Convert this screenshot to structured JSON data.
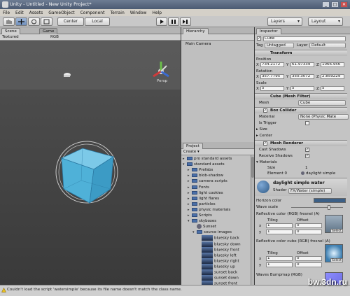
{
  "window": {
    "title": "Unity - Untitled - New Unity Project*"
  },
  "menu": [
    "File",
    "Edit",
    "Assets",
    "GameObject",
    "Component",
    "Terrain",
    "Window",
    "Help"
  ],
  "toolbar": {
    "pivot_center": "Center",
    "pivot_local": "Local",
    "layers": "Layers",
    "layout": "Layout"
  },
  "scene": {
    "tabs": [
      "Scene",
      "Game"
    ],
    "render_mode": "Textured",
    "color_mode": "RGB",
    "gizmo_label": "Persp"
  },
  "hierarchy": {
    "title": "Hierarchy",
    "items": [
      "Main Camera"
    ]
  },
  "project": {
    "title": "Project",
    "create_label": "Create ▾",
    "items": [
      {
        "label": "pro standard assets",
        "indent": 0,
        "kind": "folder",
        "arrow": "▸"
      },
      {
        "label": "standard assets",
        "indent": 0,
        "kind": "folder",
        "arrow": "▾"
      },
      {
        "label": "Prefabs",
        "indent": 1,
        "kind": "folder",
        "arrow": "▸"
      },
      {
        "label": "blob-shadow",
        "indent": 1,
        "kind": "folder",
        "arrow": "▸"
      },
      {
        "label": "camera scripts",
        "indent": 1,
        "kind": "folder",
        "arrow": "▸"
      },
      {
        "label": "Fonts",
        "indent": 1,
        "kind": "folder",
        "arrow": "▸"
      },
      {
        "label": "light cookies",
        "indent": 1,
        "kind": "folder",
        "arrow": "▸"
      },
      {
        "label": "light flares",
        "indent": 1,
        "kind": "folder",
        "arrow": "▸"
      },
      {
        "label": "particles",
        "indent": 1,
        "kind": "folder",
        "arrow": "▸"
      },
      {
        "label": "physic materials",
        "indent": 1,
        "kind": "folder",
        "arrow": "▸"
      },
      {
        "label": "Scripts",
        "indent": 1,
        "kind": "folder",
        "arrow": "▸"
      },
      {
        "label": "skyboxes",
        "indent": 1,
        "kind": "folder",
        "arrow": "▾"
      },
      {
        "label": "Sunset",
        "indent": 2,
        "kind": "sphere",
        "arrow": ""
      },
      {
        "label": "source images",
        "indent": 2,
        "kind": "folder",
        "arrow": "▾"
      },
      {
        "label": "bluesky back",
        "indent": 3,
        "kind": "thumb",
        "arrow": ""
      },
      {
        "label": "bluesky down",
        "indent": 3,
        "kind": "thumb",
        "arrow": ""
      },
      {
        "label": "bluesky front",
        "indent": 3,
        "kind": "thumb",
        "arrow": ""
      },
      {
        "label": "bluesky left",
        "indent": 3,
        "kind": "thumb",
        "arrow": ""
      },
      {
        "label": "bluesky right",
        "indent": 3,
        "kind": "thumb",
        "arrow": ""
      },
      {
        "label": "bluesky up",
        "indent": 3,
        "kind": "thumb",
        "arrow": ""
      },
      {
        "label": "sunset back",
        "indent": 3,
        "kind": "thumb",
        "arrow": ""
      },
      {
        "label": "sunset down",
        "indent": 3,
        "kind": "thumb",
        "arrow": ""
      },
      {
        "label": "sunset front",
        "indent": 3,
        "kind": "thumb",
        "arrow": ""
      }
    ]
  },
  "inspector": {
    "title": "Inspector",
    "object_name": "Cube",
    "tag_label": "Tag",
    "tag_value": "Untagged",
    "layer_label": "Layer",
    "layer_value": "Default",
    "transform": {
      "header": "Transform",
      "position_label": "Position",
      "position": {
        "x": "734.2172",
        "y": "61.97339",
        "z": "1066.956"
      },
      "rotation_label": "Rotation",
      "rotation": {
        "x": "357.7795",
        "y": "350.3072",
        "z": "2.859229"
      },
      "scale_label": "Scale",
      "scale": {
        "x": "5",
        "y": "5",
        "z": "5"
      }
    },
    "mesh_filter": {
      "header": "Cube (Mesh Filter)",
      "mesh_label": "Mesh",
      "mesh_value": "Cube"
    },
    "box_collider": {
      "header": "Box Collider",
      "material_label": "Material",
      "material_value": "None (Physic Mate",
      "is_trigger_label": "Is Trigger",
      "size_label": "Size",
      "center_label": "Center"
    },
    "mesh_renderer": {
      "header": "Mesh Renderer",
      "cast_shadows_label": "Cast Shadows",
      "receive_shadows_label": "Receive Shadows",
      "materials_label": "Materials",
      "size_label": "Size",
      "size_value": "1",
      "element_label": "Element 0",
      "element_value": "daylight simple"
    },
    "material": {
      "name": "daylight simple water",
      "shader_label": "Shader",
      "shader_value": "FX/Water (simple)",
      "horizon_label": "Horizon color",
      "horizon_color": "#3b5f86",
      "wave_scale_label": "Wave scale",
      "reflective_label": "Reflective color (RGB) fresnel (A)",
      "tiling_label": "Tiling",
      "offset_label": "Offset",
      "x_label": "x",
      "y_label": "y",
      "x_tiling": "1",
      "y_tiling": "1",
      "x_offset": "0",
      "y_offset": "0",
      "select_label": "Select",
      "cube_label": "Reflective color cube (RGB) fresnel (A)",
      "bump_label": "Waves Bumpmap (RGB)"
    }
  },
  "status": {
    "message": "Couldn't load the script 'watersimple' because its file name doesn't match the class name."
  },
  "watermark": "bw.3dn.ru",
  "colors": {
    "cube_fill": "#4fb1d8",
    "cube_edge": "#2b79a3",
    "viewport_bg": "#535353",
    "panel_bg": "#c4c4c4"
  }
}
